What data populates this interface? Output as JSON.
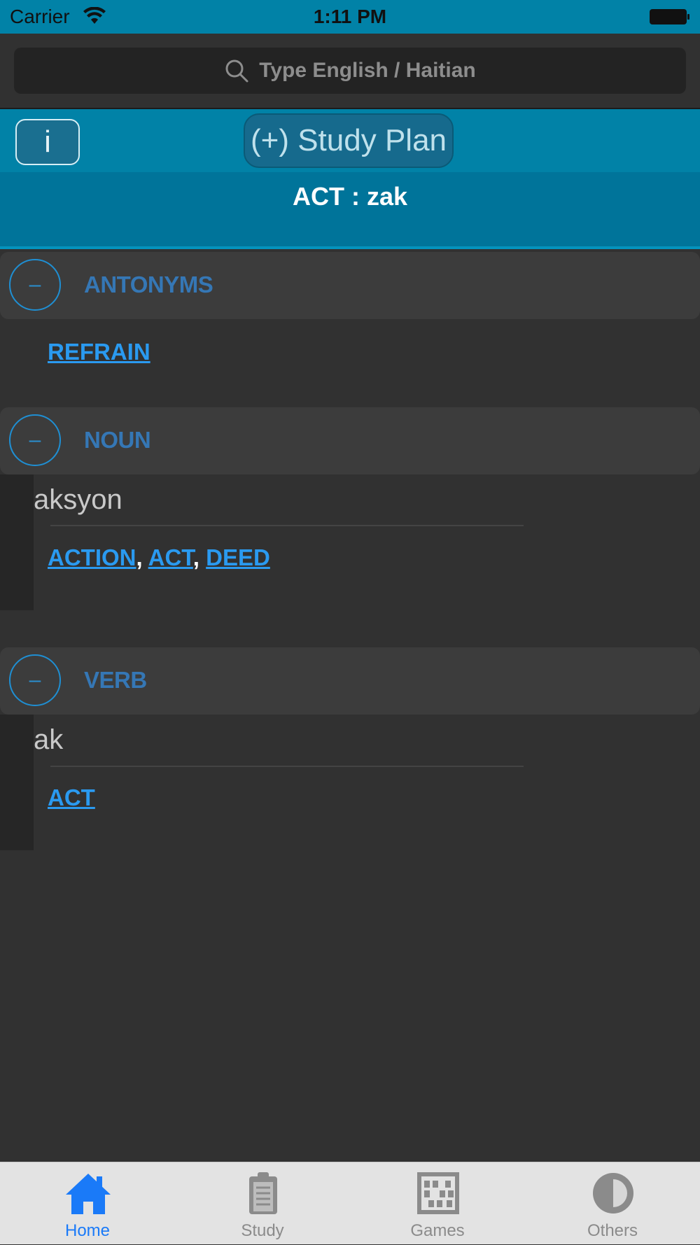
{
  "status_bar": {
    "carrier": "Carrier",
    "time": "1:11 PM"
  },
  "search": {
    "placeholder": "Type English / Haitian"
  },
  "toolbar": {
    "info_label": "i",
    "study_plan_label": "(+) Study Plan"
  },
  "word_header": {
    "title": "ACT : zak"
  },
  "sections": {
    "antonyms": {
      "collapse_symbol": "–",
      "title": "ANTONYMS",
      "links": [
        "REFRAIN"
      ]
    },
    "noun": {
      "collapse_symbol": "–",
      "title": "NOUN",
      "translation": "aksyon",
      "links": [
        "ACTION",
        "ACT",
        "DEED"
      ],
      "separator": ","
    },
    "verb": {
      "collapse_symbol": "–",
      "title": "VERB",
      "translation": "ak",
      "links": [
        "ACT"
      ]
    }
  },
  "tab_bar": {
    "tabs": [
      {
        "label": "Home",
        "icon": "home-icon",
        "active": true
      },
      {
        "label": "Study",
        "icon": "clipboard-icon",
        "active": false
      },
      {
        "label": "Games",
        "icon": "abacus-icon",
        "active": false
      },
      {
        "label": "Others",
        "icon": "half-circle-icon",
        "active": false
      }
    ]
  },
  "colors": {
    "accent_blue": "#0182a7",
    "link_blue": "#2a9af0",
    "section_title_blue": "#3577b5",
    "tab_active": "#1a7af8",
    "background": "#313131"
  }
}
